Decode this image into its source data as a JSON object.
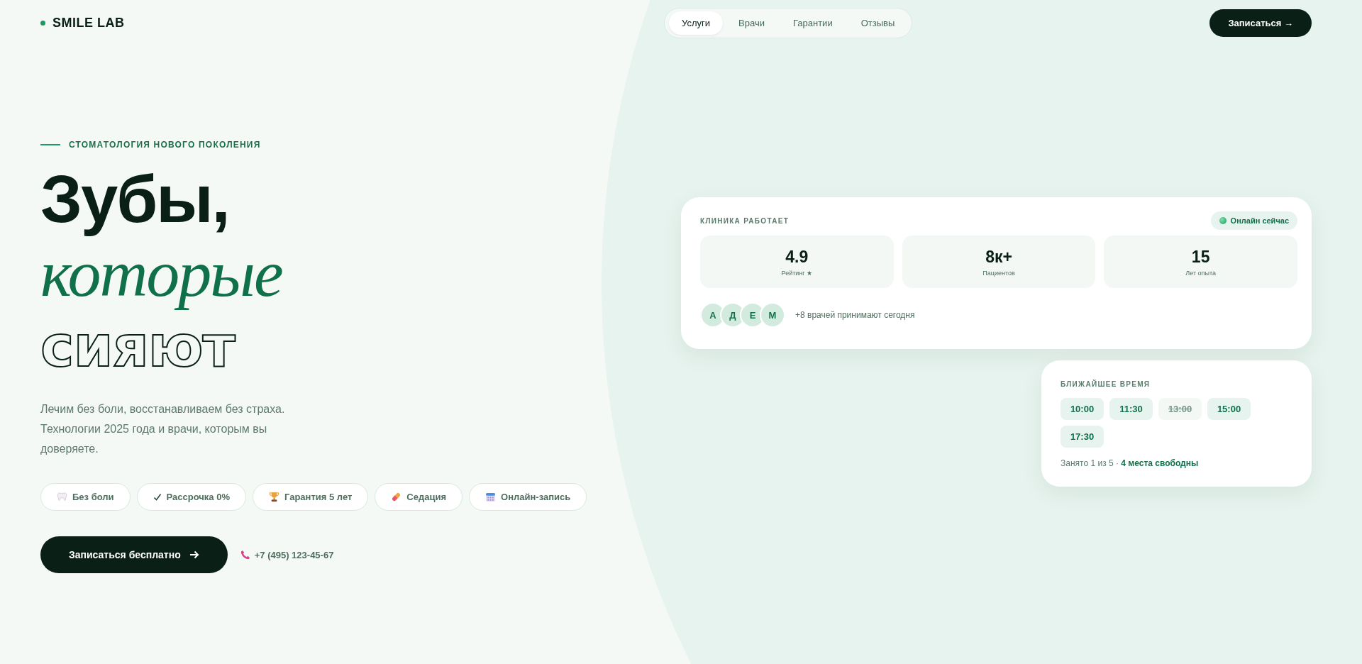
{
  "header": {
    "logo": "SMILE LAB",
    "nav": [
      {
        "label": "Услуги",
        "selected": true
      },
      {
        "label": "Врачи",
        "selected": false
      },
      {
        "label": "Гарантии",
        "selected": false
      },
      {
        "label": "Отзывы",
        "selected": false
      }
    ],
    "cta": "Записаться →"
  },
  "hero": {
    "eyebrow": "СТОМАТОЛОГИЯ НОВОГО ПОКОЛЕНИЯ",
    "title_lines": [
      {
        "kind": "solid",
        "text": "Зубы,"
      },
      {
        "kind": "italic",
        "text": "которые"
      },
      {
        "kind": "outline",
        "text": "сияют"
      }
    ],
    "lead": "Лечим без боли, восстанавливаем без страха. Технологии 2025 года и врачи, которым вы доверяете.",
    "chips": [
      {
        "kind": "tooth",
        "label": "Без боли"
      },
      {
        "kind": "check",
        "label": "Рассрочка 0%"
      },
      {
        "kind": "trophy",
        "label": "Гарантия 5 лет"
      },
      {
        "kind": "pill",
        "label": "Седация"
      },
      {
        "kind": "calendar",
        "label": "Онлайн-запись"
      }
    ],
    "primary_button": "Записаться бесплатно",
    "phone": "+7 (495) 123-45-67"
  },
  "status_card": {
    "title": "КЛИНИКА РАБОТАЕТ",
    "badge": "Онлайн сейчас",
    "stats": [
      {
        "value": "4.9",
        "label": "Рейтинг ★"
      },
      {
        "value": "8к+",
        "label": "Пациентов"
      },
      {
        "value": "15",
        "label": "Лет опыта"
      }
    ],
    "avatars": [
      "А",
      "Д",
      "Е",
      "М"
    ],
    "doctors_note": "+8 врачей принимают сегодня"
  },
  "slots_card": {
    "title": "БЛИЖАЙШЕЕ ВРЕМЯ",
    "slots": [
      {
        "time": "10:00",
        "taken": false
      },
      {
        "time": "11:30",
        "taken": false
      },
      {
        "time": "13:00",
        "taken": true
      },
      {
        "time": "15:00",
        "taken": false
      },
      {
        "time": "17:30",
        "taken": false
      }
    ],
    "note": "Занято 1 из 5 · **4 места свободны**"
  }
}
